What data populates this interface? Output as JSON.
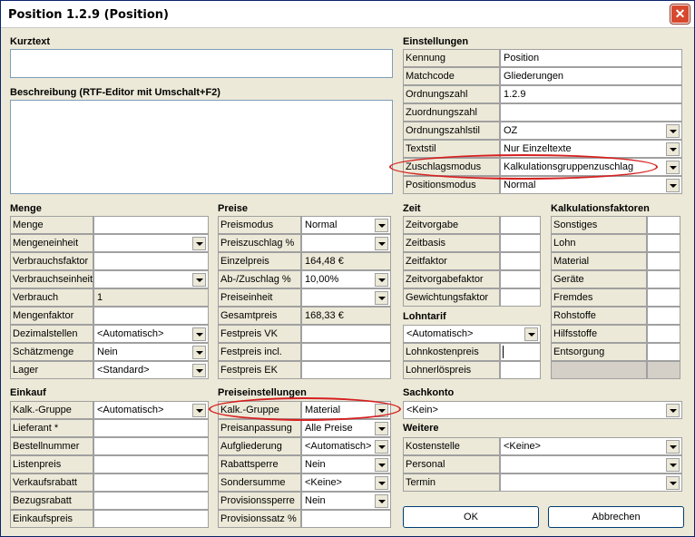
{
  "window": {
    "title": "Position 1.2.9 (Position)",
    "close": "✕"
  },
  "kurztext": {
    "label": "Kurztext",
    "value": ""
  },
  "beschreibung": {
    "label": "Beschreibung (RTF-Editor mit Umschalt+F2)",
    "value": ""
  },
  "einstellungen": {
    "title": "Einstellungen",
    "rows": [
      {
        "label": "Kennung",
        "value": "Position"
      },
      {
        "label": "Matchcode",
        "value": "Gliederungen"
      },
      {
        "label": "Ordnungszahl",
        "value": "1.2.9"
      },
      {
        "label": "Zuordnungszahl",
        "value": ""
      },
      {
        "label": "Ordnungszahlstil",
        "value": "OZ"
      },
      {
        "label": "Textstil",
        "value": "Nur Einzeltexte"
      },
      {
        "label": "Zuschlagsmodus",
        "value": "Kalkulationsgruppenzuschlag"
      },
      {
        "label": "Positionsmodus",
        "value": "Normal"
      }
    ]
  },
  "menge": {
    "title": "Menge",
    "rows": [
      {
        "label": "Menge",
        "value": ""
      },
      {
        "label": "Mengeneinheit",
        "value": ""
      },
      {
        "label": "Verbrauchsfaktor",
        "value": ""
      },
      {
        "label": "Verbrauchseinheit",
        "value": ""
      },
      {
        "label": "Verbrauch",
        "value": "1"
      },
      {
        "label": "Mengenfaktor",
        "value": ""
      },
      {
        "label": "Dezimalstellen",
        "value": "<Automatisch>"
      },
      {
        "label": "Schätzmenge",
        "value": "Nein"
      },
      {
        "label": "Lager",
        "value": "<Standard>"
      }
    ]
  },
  "preise": {
    "title": "Preise",
    "rows": [
      {
        "label": "Preismodus",
        "value": "Normal"
      },
      {
        "label": "Preiszuschlag %",
        "value": ""
      },
      {
        "label": "Einzelpreis",
        "value": "164,48 €"
      },
      {
        "label": "Ab-/Zuschlag %",
        "value": "10,00%"
      },
      {
        "label": "Preiseinheit",
        "value": ""
      },
      {
        "label": "Gesamtpreis",
        "value": "168,33 €"
      },
      {
        "label": "Festpreis VK",
        "value": ""
      },
      {
        "label": "Festpreis incl.",
        "value": ""
      },
      {
        "label": "Festpreis EK",
        "value": ""
      }
    ]
  },
  "zeit": {
    "title": "Zeit",
    "rows": [
      {
        "label": "Zeitvorgabe",
        "value": ""
      },
      {
        "label": "Zeitbasis",
        "value": ""
      },
      {
        "label": "Zeitfaktor",
        "value": ""
      },
      {
        "label": "Zeitvorgabefaktor",
        "value": ""
      },
      {
        "label": "Gewichtungsfaktor",
        "value": ""
      }
    ]
  },
  "lohntarif": {
    "title": "Lohntarif",
    "select": "<Automatisch>",
    "rows": [
      {
        "label": "Lohnkostenpreis",
        "value": ""
      },
      {
        "label": "Lohnerlöspreis",
        "value": ""
      }
    ]
  },
  "kalkulationsfaktoren": {
    "title": "Kalkulationsfaktoren",
    "rows": [
      {
        "label": "Sonstiges",
        "value": ""
      },
      {
        "label": "Lohn",
        "value": ""
      },
      {
        "label": "Material",
        "value": ""
      },
      {
        "label": "Geräte",
        "value": ""
      },
      {
        "label": "Fremdes",
        "value": ""
      },
      {
        "label": "Rohstoffe",
        "value": ""
      },
      {
        "label": "Hilfsstoffe",
        "value": ""
      },
      {
        "label": "Entsorgung",
        "value": ""
      }
    ]
  },
  "einkauf": {
    "title": "Einkauf",
    "rows": [
      {
        "label": "Kalk.-Gruppe",
        "value": "<Automatisch>"
      },
      {
        "label": "Lieferant *",
        "value": ""
      },
      {
        "label": "Bestellnummer",
        "value": ""
      },
      {
        "label": "Listenpreis",
        "value": ""
      },
      {
        "label": "Verkaufsrabatt",
        "value": ""
      },
      {
        "label": "Bezugsrabatt",
        "value": ""
      },
      {
        "label": "Einkaufspreis",
        "value": ""
      }
    ]
  },
  "preiseinstellungen": {
    "title": "Preiseinstellungen",
    "rows": [
      {
        "label": "Kalk.-Gruppe",
        "value": "Material"
      },
      {
        "label": "Preisanpassung",
        "value": "Alle Preise"
      },
      {
        "label": "Aufgliederung",
        "value": "<Automatisch>"
      },
      {
        "label": "Rabattsperre",
        "value": "Nein"
      },
      {
        "label": "Sondersumme",
        "value": "<Keine>"
      },
      {
        "label": "Provisionssperre",
        "value": "Nein"
      },
      {
        "label": "Provisionssatz %",
        "value": ""
      }
    ]
  },
  "sachkonto": {
    "title": "Sachkonto",
    "value": "<Kein>"
  },
  "weitere": {
    "title": "Weitere",
    "rows": [
      {
        "label": "Kostenstelle",
        "value": "<Keine>"
      },
      {
        "label": "Personal",
        "value": ""
      },
      {
        "label": "Termin",
        "value": ""
      }
    ]
  },
  "buttons": {
    "ok": "OK",
    "cancel": "Abbrechen"
  },
  "colors": {
    "highlight_oval": "#d62020",
    "dialog_bg": "#ece9d8"
  }
}
